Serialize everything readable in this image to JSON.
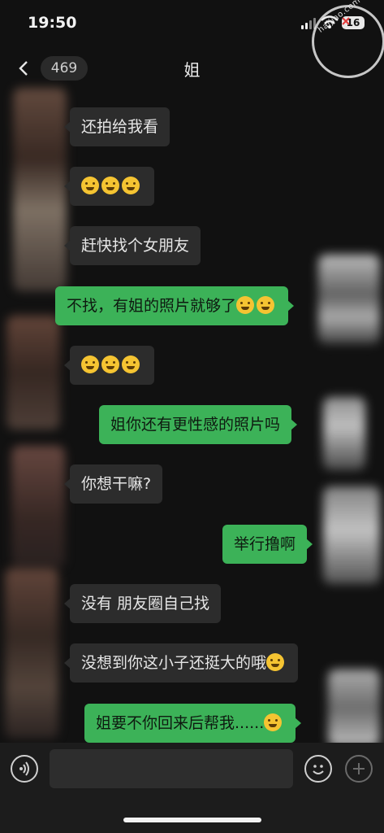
{
  "status_bar": {
    "time": "19:50",
    "battery": "16",
    "watermark_text": "haijiao.com"
  },
  "nav": {
    "unread_count": "469",
    "title": "姐"
  },
  "messages": [
    {
      "from": "them",
      "text": "还拍给我看",
      "emoji": ""
    },
    {
      "from": "them",
      "text": "",
      "emoji": "laughing-crying-emoji x3"
    },
    {
      "from": "them",
      "text": "赶快找个女朋友",
      "emoji": ""
    },
    {
      "from": "me",
      "text": "不找，有姐的照片就够了",
      "emoji": "yawn-emoji x2"
    },
    {
      "from": "them",
      "text": "",
      "emoji": "shocked-emoji x3"
    },
    {
      "from": "me",
      "text": "姐你还有更性感的照片吗",
      "emoji": ""
    },
    {
      "from": "them",
      "text": "你想干嘛?",
      "emoji": ""
    },
    {
      "from": "me",
      "text": "举行撸啊",
      "emoji": ""
    },
    {
      "from": "them",
      "text": "没有 朋友圈自己找",
      "emoji": ""
    },
    {
      "from": "them",
      "text": "没想到你这小子还挺大的哦",
      "emoji": "yawn-emoji x1"
    },
    {
      "from": "me",
      "text": "姐要不你回来后帮我......",
      "emoji": "blush-emoji x1"
    }
  ],
  "input_bar": {
    "placeholder": ""
  },
  "colors": {
    "background": "#111111",
    "incoming_bubble": "#2c2c2c",
    "outgoing_bubble": "#3cb258"
  }
}
